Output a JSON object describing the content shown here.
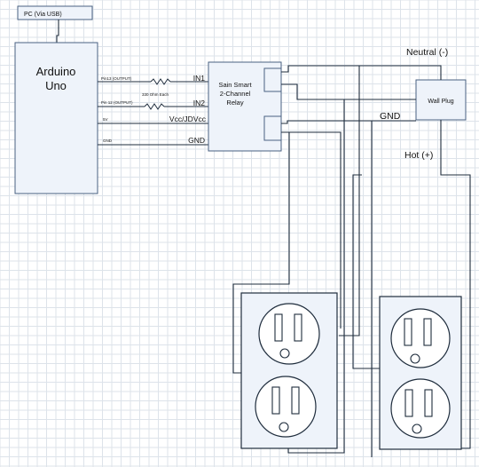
{
  "blocks": {
    "pc_label": "PC (Via USB)",
    "arduino_line1": "Arduino",
    "arduino_line2": "Uno",
    "relay_line1": "Sain Smart",
    "relay_line2": "2-Channel",
    "relay_line3": "Relay",
    "wall_plug": "Wall Plug"
  },
  "signals": {
    "pin13": "Pin13 (OUTPUT)",
    "pin12": "Pin 12 (OUTPUT)",
    "five_v": "5V",
    "gnd_small": "GND",
    "resistor_note": "330 Ohm Each"
  },
  "relay_pins": {
    "in1": "IN1",
    "in2": "IN2",
    "vcc": "Vcc/JDVcc",
    "gnd": "GND"
  },
  "mains": {
    "neutral": "Neutral (-)",
    "gnd": "GND",
    "hot": "Hot (+)"
  }
}
